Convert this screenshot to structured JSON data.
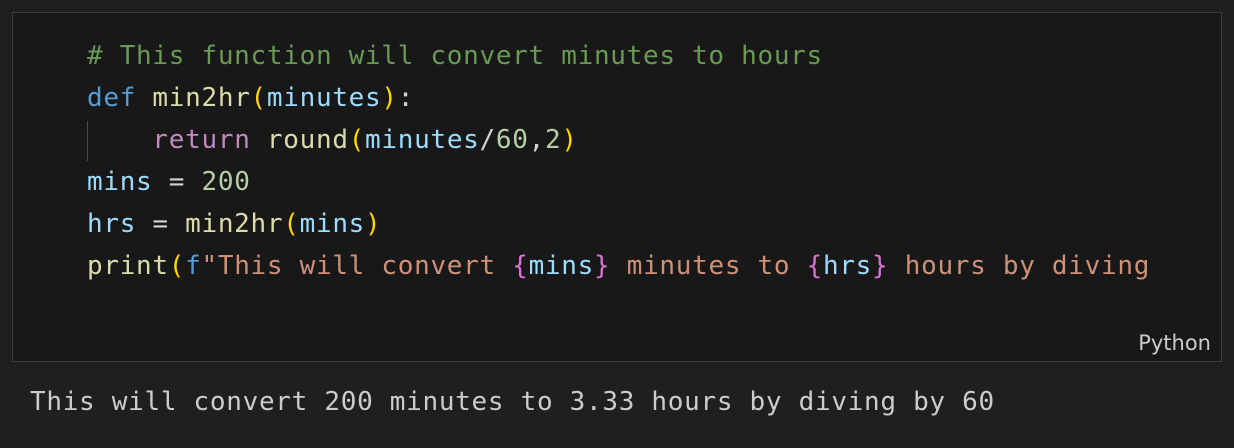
{
  "cell": {
    "language": "Python",
    "lines": [
      [
        {
          "t": "comment",
          "v": "# This function will convert minutes to hours"
        }
      ],
      [
        {
          "t": "keyword",
          "v": "def"
        },
        {
          "t": "plain",
          "v": " "
        },
        {
          "t": "func",
          "v": "min2hr"
        },
        {
          "t": "paren",
          "v": "("
        },
        {
          "t": "param",
          "v": "minutes"
        },
        {
          "t": "paren",
          "v": ")"
        },
        {
          "t": "plain",
          "v": ":"
        }
      ],
      [
        {
          "t": "plain",
          "v": "    "
        },
        {
          "t": "control",
          "v": "return"
        },
        {
          "t": "plain",
          "v": " "
        },
        {
          "t": "func",
          "v": "round"
        },
        {
          "t": "paren",
          "v": "("
        },
        {
          "t": "var",
          "v": "minutes"
        },
        {
          "t": "plain",
          "v": "/"
        },
        {
          "t": "num",
          "v": "60"
        },
        {
          "t": "plain",
          "v": ","
        },
        {
          "t": "num",
          "v": "2"
        },
        {
          "t": "paren",
          "v": ")"
        }
      ],
      [
        {
          "t": "var",
          "v": "mins"
        },
        {
          "t": "plain",
          "v": " = "
        },
        {
          "t": "num",
          "v": "200"
        }
      ],
      [
        {
          "t": "var",
          "v": "hrs"
        },
        {
          "t": "plain",
          "v": " = "
        },
        {
          "t": "func",
          "v": "min2hr"
        },
        {
          "t": "paren",
          "v": "("
        },
        {
          "t": "var",
          "v": "mins"
        },
        {
          "t": "paren",
          "v": ")"
        }
      ],
      [
        {
          "t": "func",
          "v": "print"
        },
        {
          "t": "paren",
          "v": "("
        },
        {
          "t": "fprefix",
          "v": "f"
        },
        {
          "t": "str",
          "v": "\"This will convert "
        },
        {
          "t": "brace",
          "v": "{"
        },
        {
          "t": "var",
          "v": "mins"
        },
        {
          "t": "brace",
          "v": "}"
        },
        {
          "t": "str",
          "v": " minutes to "
        },
        {
          "t": "brace",
          "v": "{"
        },
        {
          "t": "var",
          "v": "hrs"
        },
        {
          "t": "brace",
          "v": "}"
        },
        {
          "t": "str",
          "v": " hours by diving"
        }
      ]
    ]
  },
  "output": {
    "text": "This will convert 200 minutes to 3.33 hours by diving by 60"
  }
}
